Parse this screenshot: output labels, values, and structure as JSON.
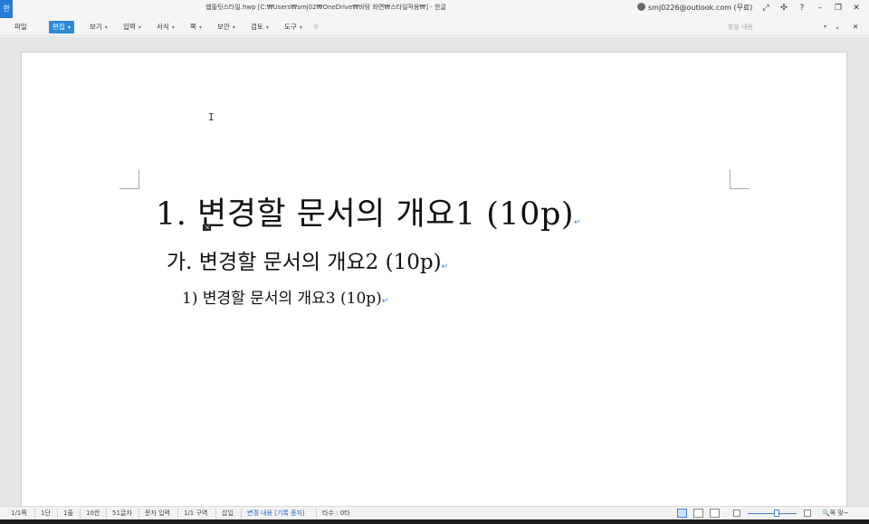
{
  "app": {
    "logo_text": "한",
    "document_title": "웹툴팃스타일.hwp [C:₩Users₩smj02₩OneDrive₩바탕 화면₩스타일적용₩] - 한글",
    "account_email": "smj0226@outlook.com (무료)"
  },
  "window_buttons": [
    "⤢",
    "✣",
    "?",
    "–",
    "❐",
    "✕"
  ],
  "menubar": {
    "file": "파일",
    "items": [
      {
        "label": "편집",
        "active": true
      },
      {
        "label": "보기"
      },
      {
        "label": "입력"
      },
      {
        "label": "서식"
      },
      {
        "label": "쪽"
      },
      {
        "label": "보안"
      },
      {
        "label": "검토"
      },
      {
        "label": "도구"
      }
    ],
    "extra_icon": "⚙",
    "style_placeholder": "찾을 내용",
    "right_icons": [
      "⌄",
      "✕"
    ]
  },
  "document": {
    "heading1": "1. 변경할 문서의 개요1 (10p)",
    "heading2": "가. 변경할 문서의 개요2 (10p)",
    "heading3": "1) 변경할 문서의 개요3 (10p)",
    "paragraph_mark": "↵",
    "cursor": "I"
  },
  "statusbar": {
    "page": "1/1쪽",
    "column": "1단",
    "line": "1줄",
    "col_pos": "10칸",
    "chars": "51글자",
    "input_mode": "문자 입력",
    "section": "1/1 구역",
    "insert_mode": "삽입",
    "track_changes": "변경 내용 [기록 중지]",
    "typing_speed": "타수 : 0타",
    "zoom_label": "🔍쪽 맞~"
  },
  "colors": {
    "accent": "#2e8ad8",
    "paragraph_mark": "#4a7fd0"
  }
}
